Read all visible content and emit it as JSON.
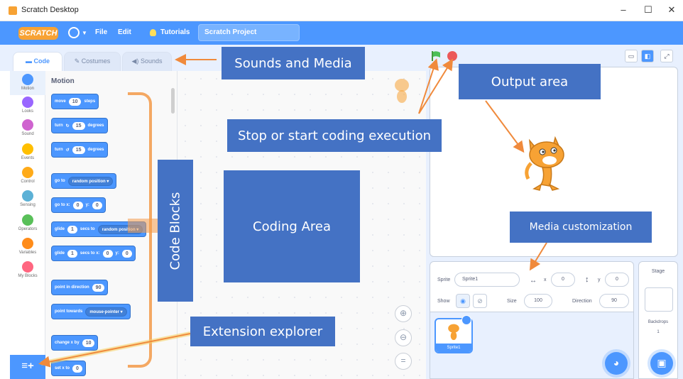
{
  "window": {
    "title": "Scratch Desktop",
    "controls": [
      "–",
      "☐",
      "✕"
    ]
  },
  "menubar": {
    "logo": "SCRATCH",
    "file": "File",
    "edit": "Edit",
    "tutorials": "Tutorials",
    "project_title": "Scratch Project"
  },
  "tabs": [
    "Code",
    "Costumes",
    "Sounds"
  ],
  "categories": [
    {
      "label": "Motion",
      "color": "#4c97ff"
    },
    {
      "label": "Looks",
      "color": "#9966ff"
    },
    {
      "label": "Sound",
      "color": "#cf63cf"
    },
    {
      "label": "Events",
      "color": "#ffbf00"
    },
    {
      "label": "Control",
      "color": "#ffab19"
    },
    {
      "label": "Sensing",
      "color": "#5cb1d6"
    },
    {
      "label": "Operators",
      "color": "#59c059"
    },
    {
      "label": "Variables",
      "color": "#ff8c1a"
    },
    {
      "label": "My Blocks",
      "color": "#ff6680"
    }
  ],
  "palette": {
    "title": "Motion",
    "blocks": {
      "move": {
        "a": "move",
        "n": "10",
        "b": "steps"
      },
      "turn_cw": {
        "a": "turn",
        "icon": "↻",
        "n": "15",
        "b": "degrees"
      },
      "turn_ccw": {
        "a": "turn",
        "icon": "↺",
        "n": "15",
        "b": "degrees"
      },
      "goto": {
        "a": "go to",
        "dd": "random position ▾"
      },
      "goto_xy": {
        "a": "go to x:",
        "x": "0",
        "y_label": "y:",
        "y": "0"
      },
      "glide": {
        "a": "glide",
        "n": "1",
        "b": "secs to",
        "dd": "random position ▾"
      },
      "glide_xy": {
        "a": "glide",
        "n": "1",
        "b": "secs to x:",
        "x": "0",
        "y_label": "y:",
        "y": "0"
      },
      "point_dir": {
        "a": "point in direction",
        "n": "90"
      },
      "point_towards": {
        "a": "point towards",
        "dd": "mouse-pointer ▾"
      },
      "change_x": {
        "a": "change x by",
        "n": "10"
      },
      "set_x": {
        "a": "set x to",
        "n": "0"
      }
    }
  },
  "zoom": {
    "in": "⊕",
    "out": "⊖",
    "reset": "="
  },
  "stage_controls": {
    "layouts": [
      "▭",
      "◧",
      "⤢"
    ]
  },
  "sprite_info": {
    "sprite_label": "Sprite",
    "sprite_name": "Sprite1",
    "x_label": "x",
    "x": "0",
    "y_label": "y",
    "y": "0",
    "show_label": "Show",
    "size_label": "Size",
    "size": "100",
    "direction_label": "Direction",
    "direction": "90"
  },
  "sprite_list": {
    "tile_name": "Sprite1"
  },
  "stage_panel": {
    "title": "Stage",
    "backdrops_label": "Backdrops",
    "backdrops_count": "1"
  },
  "annotations": {
    "sounds_media": "Sounds and Media",
    "output_area": "Output area",
    "stop_start": "Stop or start coding execution",
    "coding_area": "Coding Area",
    "code_blocks": "Code Blocks",
    "media_customization": "Media customization",
    "extension_explorer": "Extension explorer"
  },
  "colors": {
    "accent": "#4c97ff",
    "callout": "#4472c4",
    "arrow": "#f08a3c"
  }
}
